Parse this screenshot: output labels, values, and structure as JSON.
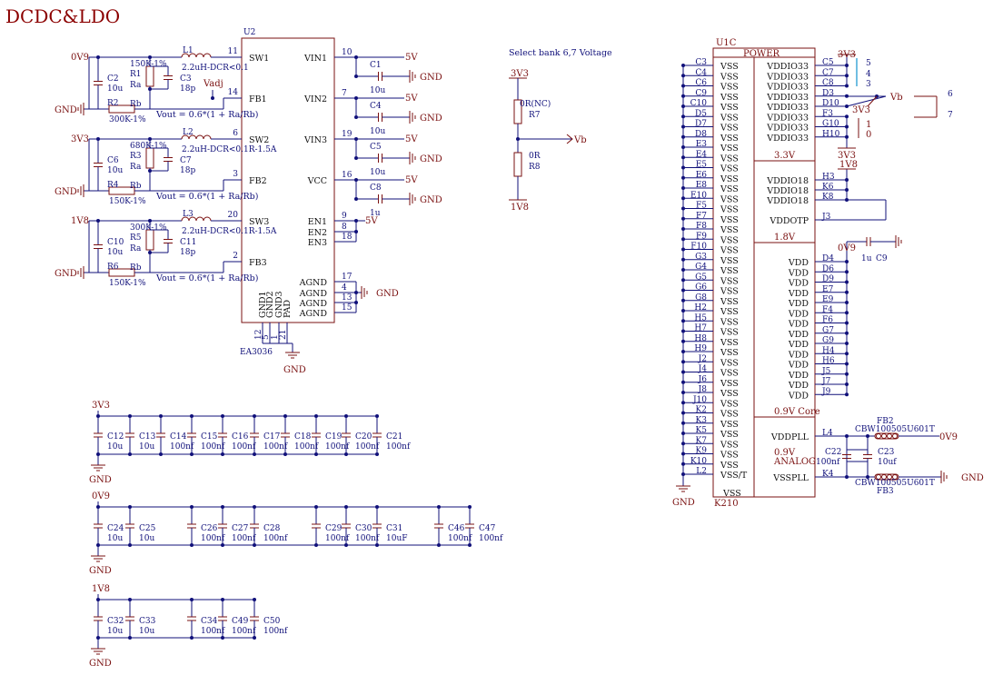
{
  "title": "DCDC&LDO",
  "regulator": {
    "ref": "U2",
    "part": "EA3036",
    "left_pins": [
      {
        "num": "11",
        "name": "SW1"
      },
      {
        "num": "14",
        "name": "FB1"
      },
      {
        "num": "6",
        "name": "SW2"
      },
      {
        "num": "3",
        "name": "FB2"
      },
      {
        "num": "20",
        "name": "SW3"
      },
      {
        "num": "2",
        "name": "FB3"
      }
    ],
    "right_pins": [
      {
        "num": "10",
        "name": "VIN1"
      },
      {
        "num": "7",
        "name": "VIN2"
      },
      {
        "num": "19",
        "name": "VIN3"
      },
      {
        "num": "16",
        "name": "VCC"
      },
      {
        "num": "9",
        "name": "EN1"
      },
      {
        "num": "8",
        "name": "EN2"
      },
      {
        "num": "18",
        "name": "EN3"
      },
      {
        "num": "17",
        "name": "AGND"
      },
      {
        "num": "4",
        "name": "AGND"
      },
      {
        "num": "13",
        "name": "AGND"
      },
      {
        "num": "15",
        "name": "AGND"
      }
    ],
    "bottom_pins": [
      {
        "num": "12",
        "name": "GND1"
      },
      {
        "num": "5",
        "name": "GND2"
      },
      {
        "num": "1",
        "name": "GND3"
      },
      {
        "num": "21",
        "name": "PAD"
      }
    ]
  },
  "buck_stages": [
    {
      "rail": "0V9",
      "inductor": "L1",
      "ind_value": "2.2uH-DCR<0.1",
      "cin": "C2",
      "cin_val": "10u",
      "r_top": "R1",
      "r_top_val": "150K-1%",
      "ra": "Ra",
      "c_ff": "C3",
      "c_ff_val": "18p",
      "r_bot": "R2",
      "r_bot_val": "300K-1%",
      "rb": "Rb",
      "formula": "Vout = 0.6*(1 + Ra/Rb)",
      "extra_net": "Vadj"
    },
    {
      "rail": "3V3",
      "inductor": "L2",
      "ind_value": "2.2uH-DCR<0.1R-1.5A",
      "cin": "C6",
      "cin_val": "10u",
      "r_top": "R3",
      "r_top_val": "680K-1%",
      "ra": "Ra",
      "c_ff": "C7",
      "c_ff_val": "18p",
      "r_bot": "R4",
      "r_bot_val": "150K-1%",
      "rb": "Rb",
      "formula": "Vout = 0.6*(1 + Ra/Rb)"
    },
    {
      "rail": "1V8",
      "inductor": "L3",
      "ind_value": "2.2uH-DCR<0.1R-1.5A",
      "cin": "C10",
      "cin_val": "10u",
      "r_top": "R5",
      "r_top_val": "300K-1%",
      "ra": "Ra",
      "c_ff": "C11",
      "c_ff_val": "18p",
      "r_bot": "R6",
      "r_bot_val": "150K-1%",
      "rb": "Rb",
      "formula": "Vout = 0.6*(1 + Ra/Rb)"
    }
  ],
  "input_caps": [
    {
      "ref": "C1",
      "val": "10u"
    },
    {
      "ref": "C4",
      "val": "10u"
    },
    {
      "ref": "C5",
      "val": "10u"
    },
    {
      "ref": "C8",
      "val": "1u"
    }
  ],
  "nets": {
    "gnd": "GND",
    "v5": "5V",
    "v3v3": "3V3",
    "v1v8": "1V8",
    "v0v9": "0V9",
    "vb": "Vb"
  },
  "bank_select": {
    "heading": "Select bank 6,7 Voltage",
    "r7": "R7",
    "r7_val": "0R(NC)",
    "r8": "R8",
    "r8_val": "0R"
  },
  "decoupling": {
    "row_3v3": [
      {
        "ref": "C12",
        "val": "10u"
      },
      {
        "ref": "C13",
        "val": "10u"
      },
      {
        "ref": "C14",
        "val": "100nf"
      },
      {
        "ref": "C15",
        "val": "100nf"
      },
      {
        "ref": "C16",
        "val": "100nf"
      },
      {
        "ref": "C17",
        "val": "100nf"
      },
      {
        "ref": "C18",
        "val": "100nf"
      },
      {
        "ref": "C19",
        "val": "100nf"
      },
      {
        "ref": "C20",
        "val": "100nf"
      },
      {
        "ref": "C21",
        "val": "100nf"
      }
    ],
    "row_0v9": [
      {
        "ref": "C24",
        "val": "10u"
      },
      {
        "ref": "C25",
        "val": "10u"
      },
      {
        "ref": "C26",
        "val": "100nf"
      },
      {
        "ref": "C27",
        "val": "100nf"
      },
      {
        "ref": "C28",
        "val": "100nf"
      },
      {
        "ref": "C29",
        "val": "100nf"
      },
      {
        "ref": "C30",
        "val": "100nf"
      },
      {
        "ref": "C31",
        "val": "10uF"
      },
      {
        "ref": "C46",
        "val": "100nf"
      },
      {
        "ref": "C47",
        "val": "100nf"
      }
    ],
    "row_1v8": [
      {
        "ref": "C32",
        "val": "10u"
      },
      {
        "ref": "C33",
        "val": "10u"
      },
      {
        "ref": "C34",
        "val": "100nf"
      },
      {
        "ref": "C49",
        "val": "100nf"
      },
      {
        "ref": "C50",
        "val": "100nf"
      }
    ]
  },
  "soc": {
    "ref": "U1C",
    "part": "K210",
    "header": "POWER",
    "vss_name": "VSS",
    "vss_last": "VSS/T",
    "vss_pins": [
      "C3",
      "C4",
      "C6",
      "C9",
      "C10",
      "D5",
      "D7",
      "D8",
      "E3",
      "E4",
      "E5",
      "E6",
      "E8",
      "E10",
      "F5",
      "F7",
      "F8",
      "F9",
      "F10",
      "G3",
      "G4",
      "G5",
      "G6",
      "G8",
      "H2",
      "H5",
      "H7",
      "H8",
      "H9",
      "J2",
      "J4",
      "J6",
      "J8",
      "J10",
      "K2",
      "K3",
      "K5",
      "K7",
      "K9",
      "K10",
      "L2"
    ],
    "vddio33": {
      "name": "VDDIO33",
      "pins": [
        "C5",
        "C7",
        "C8",
        "D3",
        "D10",
        "F3",
        "G10",
        "H10"
      ]
    },
    "side_numbers": [
      "5",
      "4",
      "3",
      "1",
      "0"
    ],
    "bank_numbers": [
      "6",
      "7"
    ],
    "section_3v3": "3.3V",
    "vddio18": {
      "name": "VDDIO18",
      "pins": [
        "H3",
        "K6",
        "K8"
      ]
    },
    "vddotp": {
      "name": "VDDOTP",
      "pin": "J3"
    },
    "c9": {
      "ref": "C9",
      "val": "1u"
    },
    "section_1v8": "1.8V",
    "vdd": {
      "name": "VDD",
      "pins": [
        "D4",
        "D6",
        "D9",
        "E7",
        "E9",
        "F4",
        "F6",
        "G7",
        "G9",
        "H4",
        "H6",
        "J5",
        "J7",
        "J9"
      ]
    },
    "section_core": "0.9V Core",
    "vddpll": {
      "name": "VDDPLL",
      "pin": "L4"
    },
    "analog_label": "0.9V",
    "analog_label2": "ANALOG",
    "vsspll": {
      "name": "VSSPLL",
      "pin": "K4"
    },
    "fb2": "FB2",
    "fb3": "FB3",
    "fb_part": "CBW100505U601T",
    "c22": {
      "ref": "C22",
      "val": "100nf"
    },
    "c23": {
      "ref": "C23",
      "val": "10uf"
    }
  },
  "colors": {
    "wire": "#10107a",
    "part": "#7a1010",
    "title": "#8b0000",
    "accent": "#40a8d8"
  }
}
